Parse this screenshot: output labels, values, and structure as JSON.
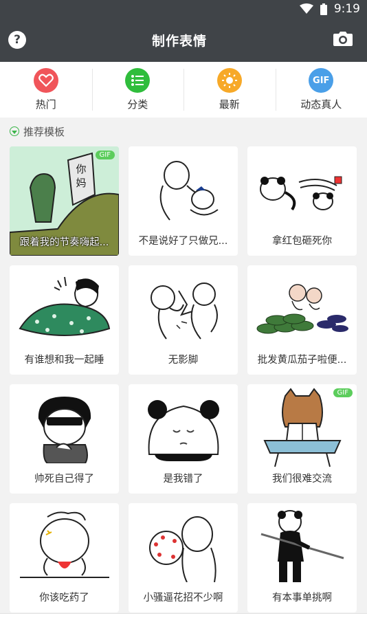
{
  "status": {
    "time": "9:19"
  },
  "header": {
    "title": "制作表情",
    "help_icon": "?"
  },
  "categories": [
    {
      "label": "热门",
      "color": "#f0555a",
      "icon": "heart-icon"
    },
    {
      "label": "分类",
      "color": "#2fbd3c",
      "icon": "list-icon"
    },
    {
      "label": "最新",
      "color": "#f7a928",
      "icon": "sun-icon"
    },
    {
      "label": "动态真人",
      "color": "#4a9fe8",
      "icon": "gif-icon",
      "badge": "GIF"
    }
  ],
  "section": {
    "title": "推荐模板"
  },
  "templates": [
    {
      "caption": "跟着我的节奏嗨起...",
      "gif": "GIF",
      "sign_text_1": "你",
      "sign_text_2": "妈"
    },
    {
      "caption": "不是说好了只做兄..."
    },
    {
      "caption": "拿红包砸死你"
    },
    {
      "caption": "有谁想和我一起睡"
    },
    {
      "caption": "无影脚"
    },
    {
      "caption": "批发黄瓜茄子啦便..."
    },
    {
      "caption": "帅死自己得了"
    },
    {
      "caption": "是我错了"
    },
    {
      "caption": "我们很难交流",
      "gif": "GIF"
    },
    {
      "caption": "你该吃药了"
    },
    {
      "caption": "小骚逼花招不少啊"
    },
    {
      "caption": "有本事单挑啊"
    }
  ]
}
